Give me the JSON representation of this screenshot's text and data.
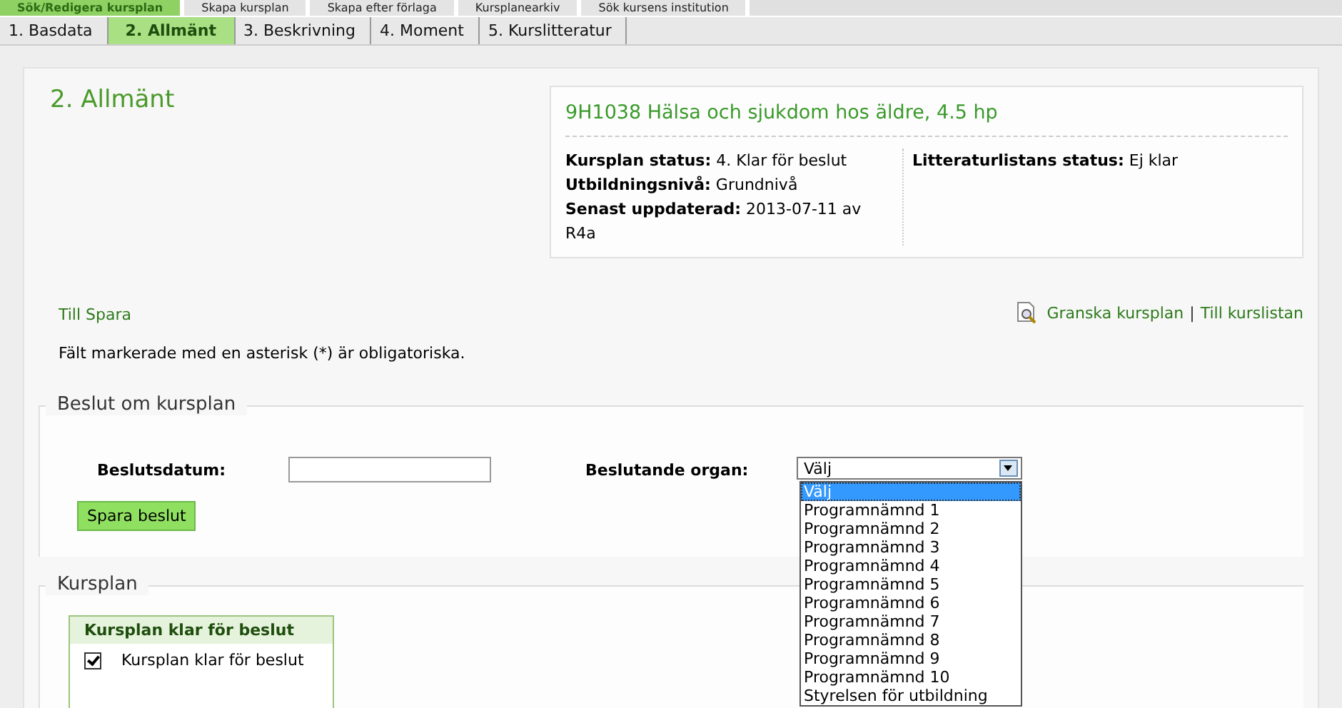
{
  "main_tabs": [
    {
      "label": "Sök/Redigera kursplan",
      "selected": true
    },
    {
      "label": "Skapa kursplan",
      "selected": false
    },
    {
      "label": "Skapa efter förlaga",
      "selected": false
    },
    {
      "label": "Kursplanearkiv",
      "selected": false
    },
    {
      "label": "Sök kursens institution",
      "selected": false
    }
  ],
  "step_tabs": [
    {
      "label": "1. Basdata",
      "selected": false
    },
    {
      "label": "2. Allmänt",
      "selected": true
    },
    {
      "label": "3. Beskrivning",
      "selected": false
    },
    {
      "label": "4. Moment",
      "selected": false
    },
    {
      "label": "5. Kurslitteratur",
      "selected": false
    }
  ],
  "page_title": "2. Allmänt",
  "course_info": {
    "title": "9H1038 Hälsa och sjukdom hos äldre, 4.5 hp",
    "fields": [
      {
        "label": "Kursplan status:",
        "value": "4. Klar för beslut"
      },
      {
        "label": "Utbildningsnivå:",
        "value": "Grundnivå"
      },
      {
        "label": "Senast uppdaterad:",
        "value": "2013-07-11 av R4a"
      }
    ],
    "side_fields": [
      {
        "label": "Litteraturlistans status:",
        "value": "Ej klar"
      }
    ]
  },
  "links": {
    "left": "Till Spara",
    "right": [
      {
        "label": "Granska kursplan",
        "kind": "icon"
      },
      {
        "label": "Till kurslistan",
        "kind": "plain"
      }
    ],
    "separator": "|"
  },
  "required_note": "Fält markerade med en asterisk (*) är obligatoriska.",
  "decision_section": {
    "legend": "Beslut om kursplan",
    "date_label": "Beslutsdatum:",
    "organ_label": "Beslutande organ:",
    "organ_value": "Välj",
    "dropdown_open": true,
    "options": [
      {
        "label": "Välj",
        "selected": true
      },
      {
        "label": "Programnämnd 1",
        "selected": false
      },
      {
        "label": "Programnämnd 2",
        "selected": false
      },
      {
        "label": "Programnämnd 3",
        "selected": false
      },
      {
        "label": "Programnämnd 4",
        "selected": false
      },
      {
        "label": "Programnämnd 5",
        "selected": false
      },
      {
        "label": "Programnämnd 6",
        "selected": false
      },
      {
        "label": "Programnämnd 7",
        "selected": false
      },
      {
        "label": "Programnämnd 8",
        "selected": false
      },
      {
        "label": "Programnämnd 9",
        "selected": false
      },
      {
        "label": "Programnämnd 10",
        "selected": false
      },
      {
        "label": "Styrelsen för utbildning",
        "selected": false
      }
    ],
    "save_button": "Spara beslut"
  },
  "plan_section": {
    "legend": "Kursplan",
    "box_title": "Kursplan klar för beslut",
    "checkbox": {
      "label": "Kursplan klar för beslut",
      "checked": true
    }
  }
}
